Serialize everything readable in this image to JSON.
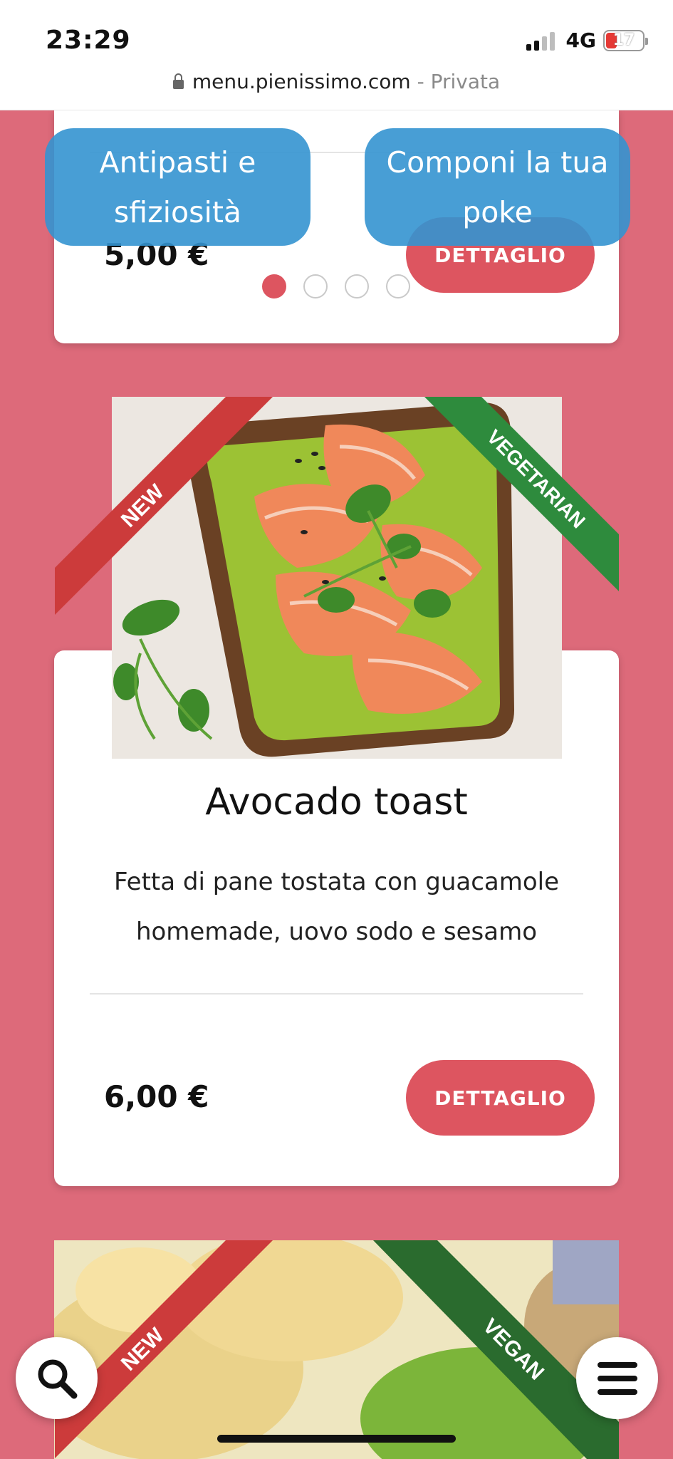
{
  "status_bar": {
    "time": "23:29",
    "network": "4G",
    "battery": "17"
  },
  "browser": {
    "url": "menu.pienissimo.com",
    "mode": "- Privata"
  },
  "categories": [
    {
      "label": "Antipasti e sfiziosità"
    },
    {
      "label": "Componi la tua poke"
    }
  ],
  "pagination": {
    "total": 4,
    "active": 1
  },
  "items": [
    {
      "price": "5,00 €",
      "button": "DETTAGLIO"
    },
    {
      "title": "Avocado toast",
      "description": "Fetta di pane tostata con guacamole homemade, uovo sodo e sesamo",
      "price": "6,00 €",
      "button": "DETTAGLIO",
      "badges": [
        "NEW",
        "VEGETARIAN"
      ]
    },
    {
      "badges": [
        "NEW",
        "VEGAN"
      ]
    }
  ],
  "colors": {
    "background": "#dd6a7a",
    "button": "#dd5560",
    "category_tab": "#3494d0",
    "ribbon_new": "#cc3b3b",
    "ribbon_vegetarian": "#2e8b3d",
    "ribbon_vegan": "#2a6b2e"
  },
  "fab": {
    "search_icon": "search-icon",
    "menu_icon": "hamburger-menu-icon"
  }
}
